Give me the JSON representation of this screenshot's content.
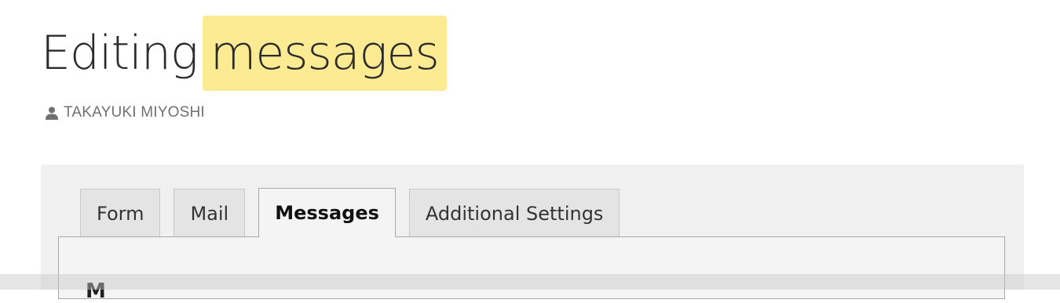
{
  "header": {
    "title_prefix": "Editing",
    "title_highlight": "messages",
    "highlight_color": "#fdeb93",
    "author": {
      "icon": "user-icon",
      "name": "TAKAYUKI MIYOSHI"
    }
  },
  "tabs": [
    {
      "label": "Form",
      "active": false
    },
    {
      "label": "Mail",
      "active": false
    },
    {
      "label": "Messages",
      "active": true
    },
    {
      "label": "Additional Settings",
      "active": false
    }
  ],
  "content": {
    "section_heading": "M"
  }
}
